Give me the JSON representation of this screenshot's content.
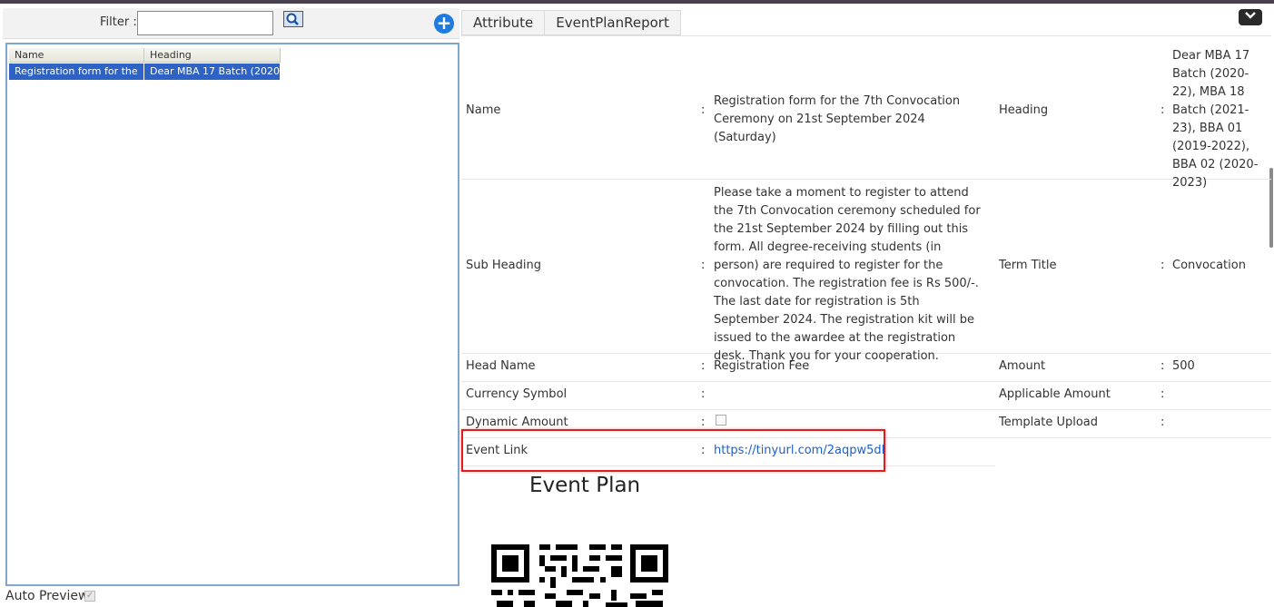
{
  "filter": {
    "label": "Filter :",
    "value": ""
  },
  "list": {
    "columns": [
      "Name",
      "Heading"
    ],
    "rows": [
      [
        "Registration form for the",
        "Dear MBA 17 Batch (2020-"
      ]
    ]
  },
  "auto_preview": "Auto Preview",
  "tabs": [
    "Attribute",
    "EventPlanReport"
  ],
  "details": {
    "name_label": "Name",
    "name_value": "Registration form for the 7th Convocation Ceremony on 21st September 2024 (Saturday)",
    "heading_label": "Heading",
    "heading_value": "Dear MBA 17 Batch (2020-22), MBA 18 Batch (2021-23), BBA 01 (2019-2022), BBA 02 (2020-2023)",
    "subheading_label": "Sub Heading",
    "subheading_value": "Please take a moment to register to attend the 7th Convocation ceremony scheduled for the 21st September 2024 by filling out this form. All degree-receiving students (in person) are required to register for the convocation. The registration fee is Rs 500/-. The last date for registration is 5th September 2024. The registration kit will be issued to the awardee at the registration desk. Thank you for your cooperation.",
    "term_title_label": "Term Title",
    "term_title_value": "Convocation",
    "head_name_label": "Head Name",
    "head_name_value": "Registration Fee",
    "amount_label": "Amount",
    "amount_value": "500",
    "currency_label": "Currency Symbol",
    "currency_value": "",
    "applicable_amount_label": "Applicable Amount",
    "applicable_amount_value": "",
    "dynamic_amount_label": "Dynamic Amount",
    "dynamic_amount_checked": false,
    "template_upload_label": "Template Upload",
    "template_upload_value": "",
    "event_link_label": "Event Link",
    "event_link_value": "https://tinyurl.com/2aqpw5dl",
    "colon": ":"
  },
  "event_plan_title": "Event Plan",
  "colors": {
    "selected_row": "#2e62c4",
    "accent": "#1e7be0",
    "highlight": "#e01d1d",
    "link": "#1a5fd0"
  },
  "icons": [
    "search-icon",
    "plus-icon",
    "chevron-down-icon",
    "checkbox-icon",
    "qr-code-icon"
  ]
}
